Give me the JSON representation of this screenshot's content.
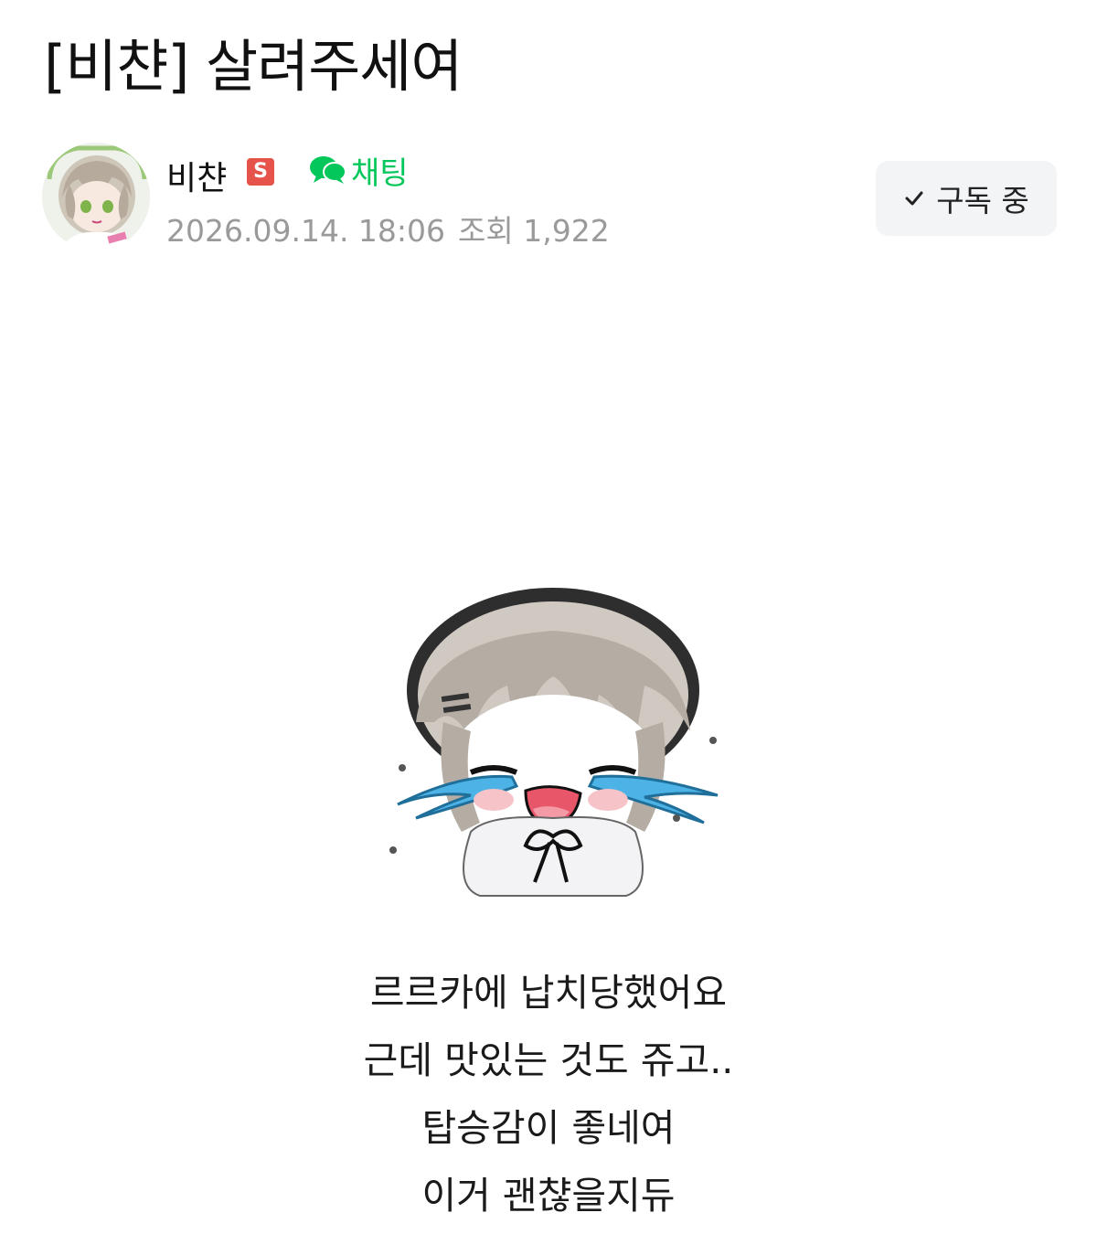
{
  "post": {
    "title": "[비챤] 살려주세여",
    "author": {
      "name": "비챤",
      "badge": "S",
      "chat_label": "채팅",
      "avatar_icon": "avatar-anime-girl"
    },
    "meta": {
      "date": "2026.09.14. 18:06",
      "views": "조회 1,922"
    },
    "subscribe": {
      "label": "구독 중",
      "icon": "check-icon"
    },
    "body_lines": [
      "르르카에 납치당했어요",
      "근데 맛있는 것도 쥬고..",
      "탑승감이 좋네여",
      "이거 괜챦을지듀"
    ]
  },
  "colors": {
    "accent_green": "#03c75a",
    "badge_red": "#e5534b",
    "meta_gray": "#9a9a9a",
    "button_bg": "#f3f4f6"
  }
}
